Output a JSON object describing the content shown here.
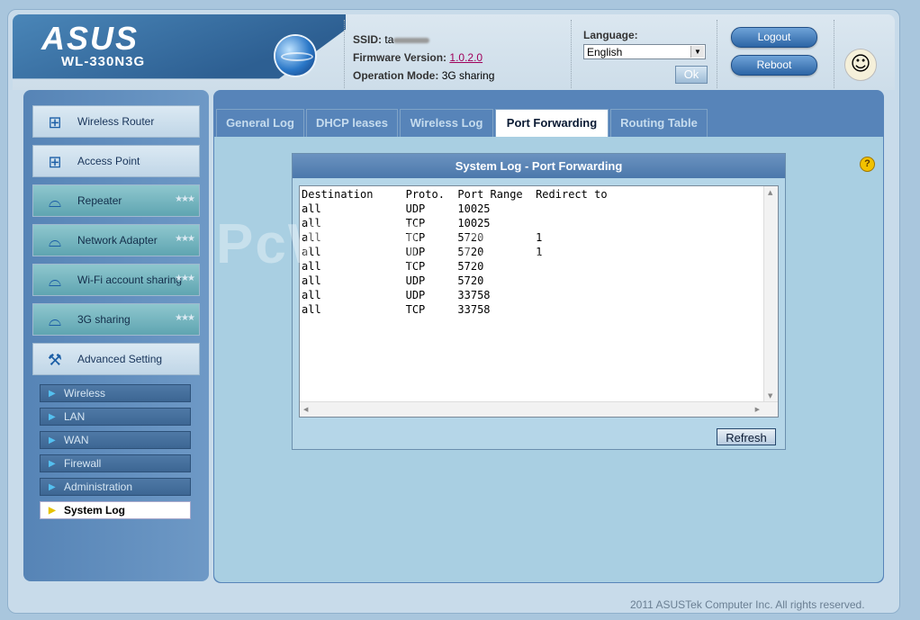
{
  "header": {
    "brand_logo": "ASUS",
    "brand_model": "WL-330N3G",
    "ssid_label": "SSID:",
    "ssid_value": "ta",
    "firmware_label": "Firmware Version:",
    "firmware_value": "1.0.2.0",
    "opmode_label": "Operation Mode:",
    "opmode_value": "3G sharing",
    "language_label": "Language:",
    "language_value": "English",
    "ok_label": "Ok",
    "logout_label": "Logout",
    "reboot_label": "Reboot"
  },
  "sidebar": {
    "items": [
      {
        "label": "Wireless Router",
        "icon": "network-icon"
      },
      {
        "label": "Access Point",
        "icon": "network-icon"
      },
      {
        "label": "Repeater",
        "icon": "wifi-router-icon"
      },
      {
        "label": "Network Adapter",
        "icon": "wifi-router-icon"
      },
      {
        "label": "Wi-Fi account sharing",
        "icon": "wifi-router-icon"
      },
      {
        "label": "3G sharing",
        "icon": "wifi-router-icon"
      },
      {
        "label": "Advanced Setting",
        "icon": "tools-icon"
      }
    ],
    "subitems": [
      {
        "label": "Wireless"
      },
      {
        "label": "LAN"
      },
      {
        "label": "WAN"
      },
      {
        "label": "Firewall"
      },
      {
        "label": "Administration"
      },
      {
        "label": "System Log"
      }
    ]
  },
  "tabs": [
    {
      "label": "General Log"
    },
    {
      "label": "DHCP leases"
    },
    {
      "label": "Wireless Log"
    },
    {
      "label": "Port Forwarding"
    },
    {
      "label": "Routing Table"
    }
  ],
  "panel": {
    "title": "System Log - Port Forwarding",
    "log_text": "Destination     Proto.  Port Range  Redirect to\nall             UDP     10025\nall             TCP     10025\nall             TCP     5720        1\nall             UDP     5720        1\nall             TCP     5720\nall             UDP     5720\nall             UDP     33758\nall             TCP     33758",
    "refresh_label": "Refresh"
  },
  "watermark": "PcWinTech.com",
  "footer": "2011 ASUSTek Computer Inc. All rights reserved."
}
